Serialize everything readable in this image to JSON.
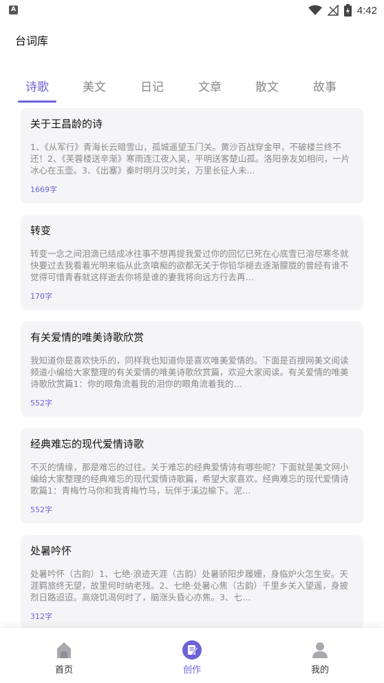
{
  "status_bar": {
    "app_badge": "A",
    "time": "4:42",
    "icons": [
      "wifi-icon",
      "signal-icon",
      "battery-icon"
    ]
  },
  "app_title": "台词库",
  "tabs": [
    {
      "label": "诗歌",
      "active": true
    },
    {
      "label": "美文",
      "active": false
    },
    {
      "label": "日记",
      "active": false
    },
    {
      "label": "文章",
      "active": false
    },
    {
      "label": "散文",
      "active": false
    },
    {
      "label": "故事",
      "active": false
    }
  ],
  "articles": [
    {
      "title": "关于王昌龄的诗",
      "excerpt": "1、《从军行》青海长云暗雪山，孤城遥望玉门关。黄沙百战穿金甲，不破楼兰终不还！2、《芙蓉楼送辛渐》寒雨连江夜入吴，平明送客楚山孤。洛阳亲友如相问，一片冰心在玉壶。3、《出塞》秦时明月汉时关，万里长征人未…",
      "count": "1669字"
    },
    {
      "title": "转变",
      "excerpt": "转变一念之间泪滴已结成冰往事不想再提我爱过你的回忆已死在心底雪已溶尽寒冬就快要过去我看着光明来临从此贪嗔痴的欲都无关于你铅华褪去逐渐朦胧的曾经有谁不觉得可惜青春就这样逝去你将是谁的妻我将向远方行去再…",
      "count": "170字"
    },
    {
      "title": "有关爱情的唯美诗歌欣赏",
      "excerpt": "我知道你是喜欢快乐的，同样我也知道你是喜欢唯美爱情的。下面是百搜网美文阅读频道小编给大家整理的有关爱情的唯美诗歌欣赏篇，欢迎大家阅读。有关爱情的唯美诗歌欣赏篇1：你的眼角流着我的泪你的眼角流着我的…",
      "count": "552字"
    },
    {
      "title": "经典难忘的现代爱情诗歌",
      "excerpt": "不灭的情缘，那是难忘的过往。关于难忘的经典爱情诗有哪些呢？下面就是美文网小编给大家整理的经典难忘的现代爱情诗歌篇，希望大家喜欢。经典难忘的现代爱情诗歌篇1：青梅竹马你和我青梅竹马，玩伴于溪边榆下。泥…",
      "count": "552字"
    },
    {
      "title": "处暑吟怀",
      "excerpt": "处暑吟怀（古韵）1、七绝·浪迹天涯（古韵）处暑骄阳步履姗，身临炉火怎生安。天涯羁旅终无望，故里何时纳老残。2、七绝·处暑心焦（古韵）千里乡关入望遥，身披烈日路迢迢。高烧饥渴何时了，脑涨头昏心亦焦。3、七…",
      "count": "312字"
    }
  ],
  "bottom_nav": [
    {
      "label": "首页",
      "icon": "home-icon",
      "active": false
    },
    {
      "label": "创作",
      "icon": "edit-icon",
      "active": true
    },
    {
      "label": "我的",
      "icon": "profile-icon",
      "active": false
    }
  ],
  "colors": {
    "accent": "#6c63d9",
    "card_bg": "#f5f5f7",
    "muted_text": "#8a8a8a",
    "nav_icon_grey": "#a8a8b0"
  }
}
